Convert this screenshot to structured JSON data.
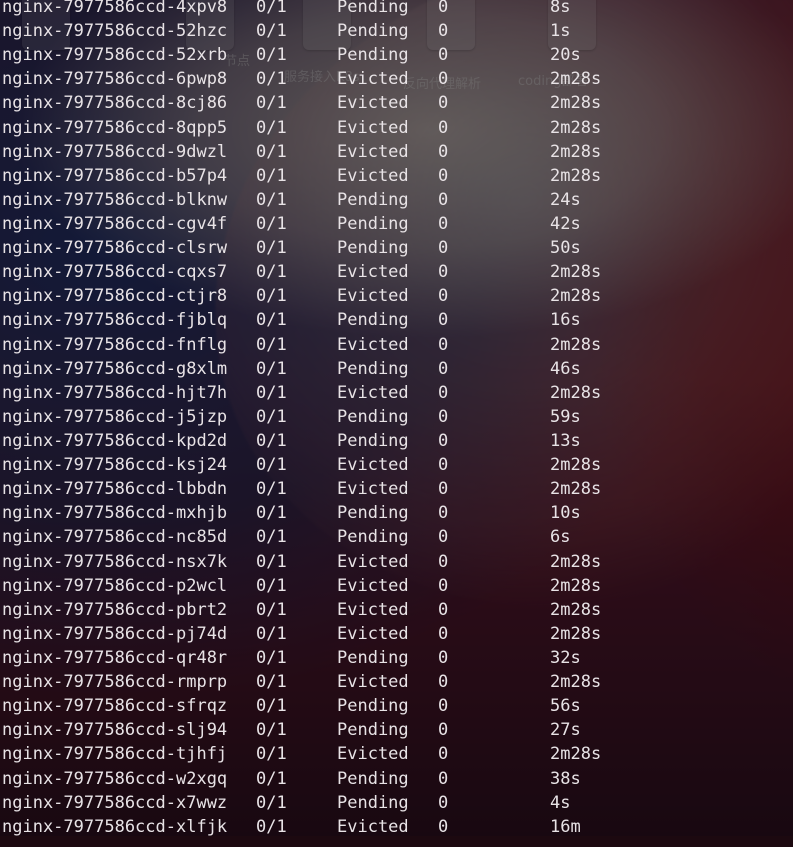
{
  "desktop": {
    "labels": [
      "节点",
      "服务接入K8s",
      "反向代理解析",
      "coding部署"
    ]
  },
  "terminal": {
    "rows": [
      {
        "name": "nginx-7977586ccd-4xpv8",
        "ready": "0/1",
        "status": "Pending",
        "restarts": "0",
        "age": "8s"
      },
      {
        "name": "nginx-7977586ccd-52hzc",
        "ready": "0/1",
        "status": "Pending",
        "restarts": "0",
        "age": "1s"
      },
      {
        "name": "nginx-7977586ccd-52xrb",
        "ready": "0/1",
        "status": "Pending",
        "restarts": "0",
        "age": "20s"
      },
      {
        "name": "nginx-7977586ccd-6pwp8",
        "ready": "0/1",
        "status": "Evicted",
        "restarts": "0",
        "age": "2m28s"
      },
      {
        "name": "nginx-7977586ccd-8cj86",
        "ready": "0/1",
        "status": "Evicted",
        "restarts": "0",
        "age": "2m28s"
      },
      {
        "name": "nginx-7977586ccd-8qpp5",
        "ready": "0/1",
        "status": "Evicted",
        "restarts": "0",
        "age": "2m28s"
      },
      {
        "name": "nginx-7977586ccd-9dwzl",
        "ready": "0/1",
        "status": "Evicted",
        "restarts": "0",
        "age": "2m28s"
      },
      {
        "name": "nginx-7977586ccd-b57p4",
        "ready": "0/1",
        "status": "Evicted",
        "restarts": "0",
        "age": "2m28s"
      },
      {
        "name": "nginx-7977586ccd-blknw",
        "ready": "0/1",
        "status": "Pending",
        "restarts": "0",
        "age": "24s"
      },
      {
        "name": "nginx-7977586ccd-cgv4f",
        "ready": "0/1",
        "status": "Pending",
        "restarts": "0",
        "age": "42s"
      },
      {
        "name": "nginx-7977586ccd-clsrw",
        "ready": "0/1",
        "status": "Pending",
        "restarts": "0",
        "age": "50s"
      },
      {
        "name": "nginx-7977586ccd-cqxs7",
        "ready": "0/1",
        "status": "Evicted",
        "restarts": "0",
        "age": "2m28s"
      },
      {
        "name": "nginx-7977586ccd-ctjr8",
        "ready": "0/1",
        "status": "Evicted",
        "restarts": "0",
        "age": "2m28s"
      },
      {
        "name": "nginx-7977586ccd-fjblq",
        "ready": "0/1",
        "status": "Pending",
        "restarts": "0",
        "age": "16s"
      },
      {
        "name": "nginx-7977586ccd-fnflg",
        "ready": "0/1",
        "status": "Evicted",
        "restarts": "0",
        "age": "2m28s"
      },
      {
        "name": "nginx-7977586ccd-g8xlm",
        "ready": "0/1",
        "status": "Pending",
        "restarts": "0",
        "age": "46s"
      },
      {
        "name": "nginx-7977586ccd-hjt7h",
        "ready": "0/1",
        "status": "Evicted",
        "restarts": "0",
        "age": "2m28s"
      },
      {
        "name": "nginx-7977586ccd-j5jzp",
        "ready": "0/1",
        "status": "Pending",
        "restarts": "0",
        "age": "59s"
      },
      {
        "name": "nginx-7977586ccd-kpd2d",
        "ready": "0/1",
        "status": "Pending",
        "restarts": "0",
        "age": "13s"
      },
      {
        "name": "nginx-7977586ccd-ksj24",
        "ready": "0/1",
        "status": "Evicted",
        "restarts": "0",
        "age": "2m28s"
      },
      {
        "name": "nginx-7977586ccd-lbbdn",
        "ready": "0/1",
        "status": "Evicted",
        "restarts": "0",
        "age": "2m28s"
      },
      {
        "name": "nginx-7977586ccd-mxhjb",
        "ready": "0/1",
        "status": "Pending",
        "restarts": "0",
        "age": "10s"
      },
      {
        "name": "nginx-7977586ccd-nc85d",
        "ready": "0/1",
        "status": "Pending",
        "restarts": "0",
        "age": "6s"
      },
      {
        "name": "nginx-7977586ccd-nsx7k",
        "ready": "0/1",
        "status": "Evicted",
        "restarts": "0",
        "age": "2m28s"
      },
      {
        "name": "nginx-7977586ccd-p2wcl",
        "ready": "0/1",
        "status": "Evicted",
        "restarts": "0",
        "age": "2m28s"
      },
      {
        "name": "nginx-7977586ccd-pbrt2",
        "ready": "0/1",
        "status": "Evicted",
        "restarts": "0",
        "age": "2m28s"
      },
      {
        "name": "nginx-7977586ccd-pj74d",
        "ready": "0/1",
        "status": "Evicted",
        "restarts": "0",
        "age": "2m28s"
      },
      {
        "name": "nginx-7977586ccd-qr48r",
        "ready": "0/1",
        "status": "Pending",
        "restarts": "0",
        "age": "32s"
      },
      {
        "name": "nginx-7977586ccd-rmprp",
        "ready": "0/1",
        "status": "Evicted",
        "restarts": "0",
        "age": "2m28s"
      },
      {
        "name": "nginx-7977586ccd-sfrqz",
        "ready": "0/1",
        "status": "Pending",
        "restarts": "0",
        "age": "56s"
      },
      {
        "name": "nginx-7977586ccd-slj94",
        "ready": "0/1",
        "status": "Pending",
        "restarts": "0",
        "age": "27s"
      },
      {
        "name": "nginx-7977586ccd-tjhfj",
        "ready": "0/1",
        "status": "Evicted",
        "restarts": "0",
        "age": "2m28s"
      },
      {
        "name": "nginx-7977586ccd-w2xgq",
        "ready": "0/1",
        "status": "Pending",
        "restarts": "0",
        "age": "38s"
      },
      {
        "name": "nginx-7977586ccd-x7wwz",
        "ready": "0/1",
        "status": "Pending",
        "restarts": "0",
        "age": "4s"
      },
      {
        "name": "nginx-7977586ccd-xlfjk",
        "ready": "0/1",
        "status": "Evicted",
        "restarts": "0",
        "age": "16m"
      }
    ]
  }
}
